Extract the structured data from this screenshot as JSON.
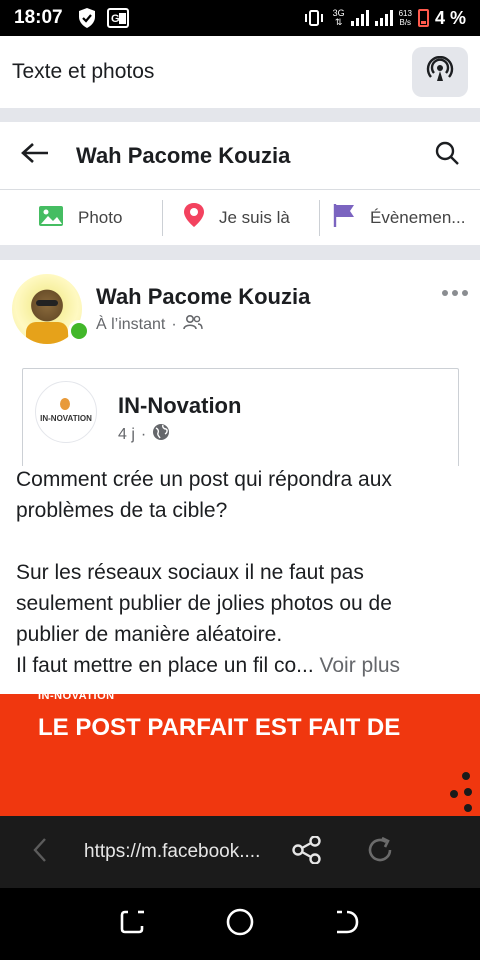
{
  "status_bar": {
    "time": "18:07",
    "network_type": "3G",
    "speed_value": "613",
    "speed_unit": "B/s",
    "battery_text": "4 %"
  },
  "compose": {
    "title": "Texte et photos"
  },
  "profile_header": {
    "name": "Wah Pacome Kouzia"
  },
  "actions": [
    {
      "label": "Photo",
      "icon": "photo-icon",
      "color": "#45bd62"
    },
    {
      "label": "Je suis là",
      "icon": "location-pin-icon",
      "color": "#f3425f"
    },
    {
      "label": "Évènemen...",
      "icon": "flag-icon",
      "color": "#7b64c0"
    }
  ],
  "post": {
    "author": "Wah Pacome Kouzia",
    "time": "À l’instant",
    "separator": "·"
  },
  "shared": {
    "page_name": "IN-Novation",
    "logo_text": "IN-NOVATION",
    "time": "4 j",
    "separator": "·",
    "text_line1": "Comment crée un post qui répondra aux",
    "text_line2": "problèmes de ta cible?",
    "text_line3": "Sur les réseaux sociaux il ne faut pas",
    "text_line4": "seulement publier de jolies photos ou de",
    "text_line5": "publier de manière aléatoire.",
    "text_line6": "Il faut mettre en place un fil co...",
    "see_more": "Voir plus"
  },
  "banner": {
    "brand": "IN-NOVATION",
    "headline": "LE POST PARFAIT EST FAIT DE",
    "color": "#f0370f"
  },
  "browser": {
    "url": "https://m.facebook...."
  },
  "colors": {
    "online": "#42b72a",
    "divider": "#e4e6eb",
    "secondary_text": "#65676b"
  }
}
